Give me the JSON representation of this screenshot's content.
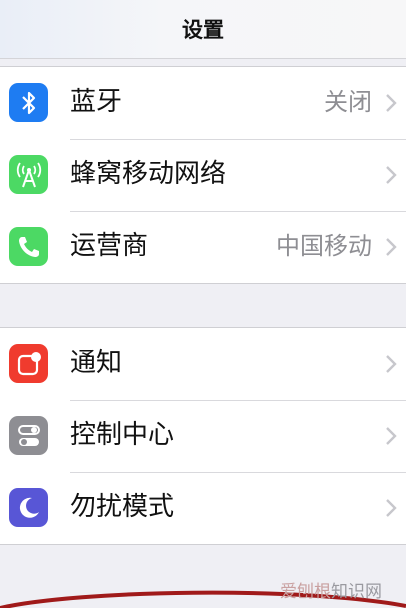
{
  "nav": {
    "title": "设置"
  },
  "group1": [
    {
      "label": "蓝牙",
      "detail": "关闭",
      "icon": "bluetooth-icon",
      "color": "#1e7cf2"
    },
    {
      "label": "蜂窝移动网络",
      "detail": "",
      "icon": "cellular-antenna-icon",
      "color": "#4cd964"
    },
    {
      "label": "运营商",
      "detail": "中国移动",
      "icon": "phone-icon",
      "color": "#4cd964"
    }
  ],
  "group2": [
    {
      "label": "通知",
      "detail": "",
      "icon": "notifications-icon",
      "color": "#f03b2e"
    },
    {
      "label": "控制中心",
      "detail": "",
      "icon": "control-center-icon",
      "color": "#8e8e93"
    },
    {
      "label": "勿扰模式",
      "detail": "",
      "icon": "moon-icon",
      "color": "#5856d6"
    }
  ],
  "watermark": {
    "text_a": "爱刨根",
    "text_b": "知识网"
  }
}
